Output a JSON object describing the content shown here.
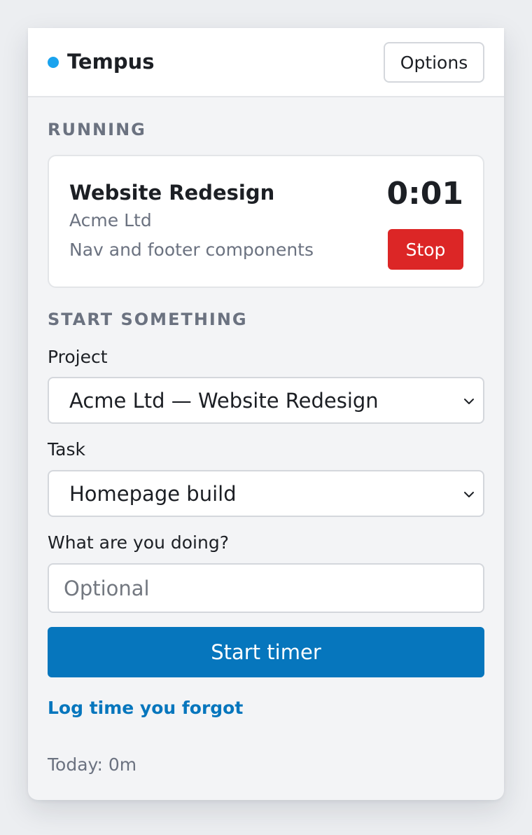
{
  "colors": {
    "brand_dot": "#1aa3ee",
    "stop": "#dc2626",
    "primary": "#0676bd",
    "link": "#0676bd"
  },
  "header": {
    "app_name": "Tempus",
    "options_label": "Options"
  },
  "running": {
    "section_title": "RUNNING",
    "project": "Website Redesign",
    "client": "Acme Ltd",
    "note": "Nav and footer components",
    "elapsed": "0:01",
    "stop_label": "Stop"
  },
  "start": {
    "section_title": "START SOMETHING",
    "project_label": "Project",
    "project_value": "Acme Ltd — Website Redesign",
    "task_label": "Task",
    "task_value": "Homepage build",
    "doing_label": "What are you doing?",
    "doing_placeholder": "Optional",
    "start_label": "Start timer",
    "icons": [
      "chevron-down-icon"
    ]
  },
  "footer": {
    "forgot_link": "Log time you forgot",
    "today": "Today: 0m"
  }
}
